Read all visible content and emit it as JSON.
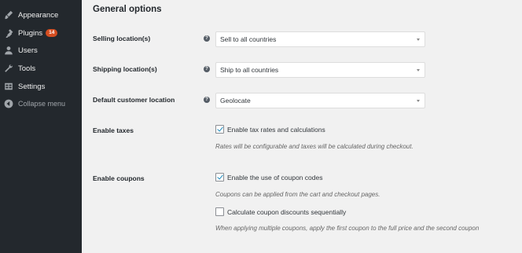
{
  "sidebar": {
    "items": [
      {
        "label": "Appearance",
        "icon": "paintbrush-icon"
      },
      {
        "label": "Plugins",
        "icon": "plugin-icon",
        "badge": "14"
      },
      {
        "label": "Users",
        "icon": "user-icon"
      },
      {
        "label": "Tools",
        "icon": "wrench-icon"
      },
      {
        "label": "Settings",
        "icon": "settings-icon"
      },
      {
        "label": "Collapse menu",
        "icon": "collapse-icon"
      }
    ]
  },
  "main": {
    "heading": "General options",
    "selling": {
      "label": "Selling location(s)",
      "value": "Sell to all countries"
    },
    "shipping": {
      "label": "Shipping location(s)",
      "value": "Ship to all countries"
    },
    "default_location": {
      "label": "Default customer location",
      "value": "Geolocate"
    },
    "taxes": {
      "label": "Enable taxes",
      "checkbox_label": "Enable tax rates and calculations",
      "checked": true,
      "description": "Rates will be configurable and taxes will be calculated during checkout."
    },
    "coupons": {
      "label": "Enable coupons",
      "checkbox_label": "Enable the use of coupon codes",
      "checked": true,
      "description": "Coupons can be applied from the cart and checkout pages.",
      "sequential_label": "Calculate coupon discounts sequentially",
      "sequential_checked": false,
      "sequential_description": "When applying multiple coupons, apply the first coupon to the full price and the second coupon"
    },
    "help_glyph": "?"
  },
  "colors": {
    "sidebar_bg": "#23282d",
    "badge": "#d54e21",
    "page_bg": "#f1f1f1"
  }
}
